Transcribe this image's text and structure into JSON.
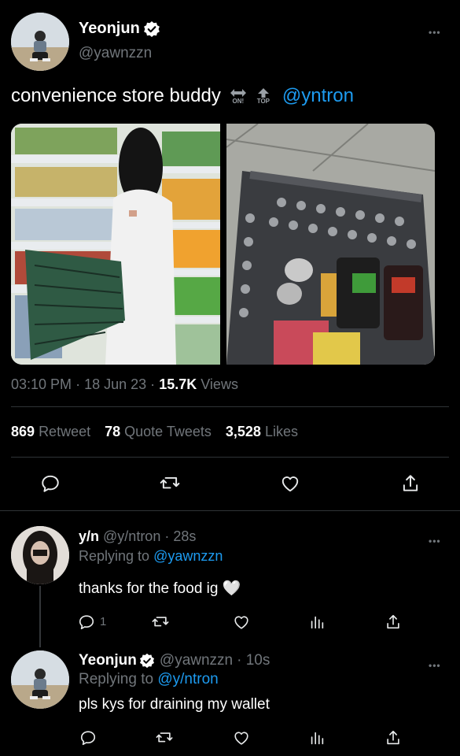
{
  "tweet": {
    "author_name": "Yeonjun",
    "author_handle": "@yawnzzn",
    "text": "convenience store buddy",
    "emoji_on": "ON!",
    "emoji_top": "TOP",
    "mention": "@yntron",
    "time": "03:10 PM",
    "sep1": "·",
    "date": "18 Jun 23",
    "sep2": "·",
    "views_count": "15.7K",
    "views_label": "Views",
    "stats": {
      "retweet_count": "869",
      "retweet_label": "Retweet",
      "quote_count": "78",
      "quote_label": "Quote Tweets",
      "likes_count": "3,528",
      "likes_label": "Likes"
    }
  },
  "replies": [
    {
      "name": "y/n",
      "handle": "@y/ntron",
      "age": "· 28s",
      "replying_prefix": "Replying to",
      "replying_to": "@yawnzzn",
      "text": "thanks for the food ig 🤍",
      "reply_count": "1"
    },
    {
      "name": "Yeonjun",
      "handle": "@yawnzzn",
      "age": "· 10s",
      "replying_prefix": "Replying to",
      "replying_to": "@y/ntron",
      "text": "pls kys for draining my wallet"
    }
  ],
  "more_glyph": "•••",
  "colors": {
    "background": "#000000",
    "accent": "#1d9bf0",
    "muted": "#71767b",
    "like": "#e7e9ea"
  }
}
